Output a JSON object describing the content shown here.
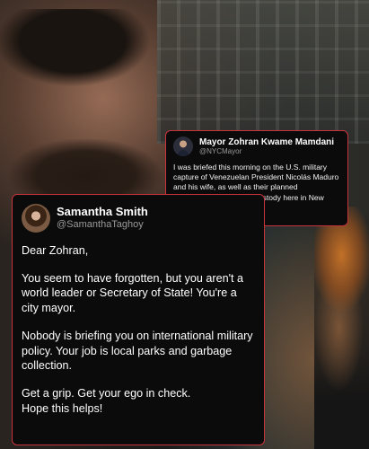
{
  "mayor_tweet": {
    "name": "Mayor Zohran Kwame Mamdani",
    "handle": "@NYCMayor",
    "text": "I was briefed this morning on the U.S. military capture of Venezuelan President Nicolás Maduro and his wife, as well as their planned imprisonment in federal custody here in New York City."
  },
  "reply_tweet": {
    "name": "Samantha Smith",
    "handle": "@SamanthaTaghoy",
    "greeting": "Dear Zohran,",
    "paragraphs": [
      "You seem to have forgotten, but you aren't a world leader or Secretary of State! You're a city mayor.",
      "Nobody is briefing you on international military policy. Your job is local parks and garbage collection."
    ],
    "closing_line1": "Get a grip. Get your ego in check.",
    "closing_line2": "Hope this helps!"
  },
  "colors": {
    "border_accent": "#c8343b",
    "card_background": "#0b0b0b",
    "handle_gray": "#9a9a9a"
  }
}
